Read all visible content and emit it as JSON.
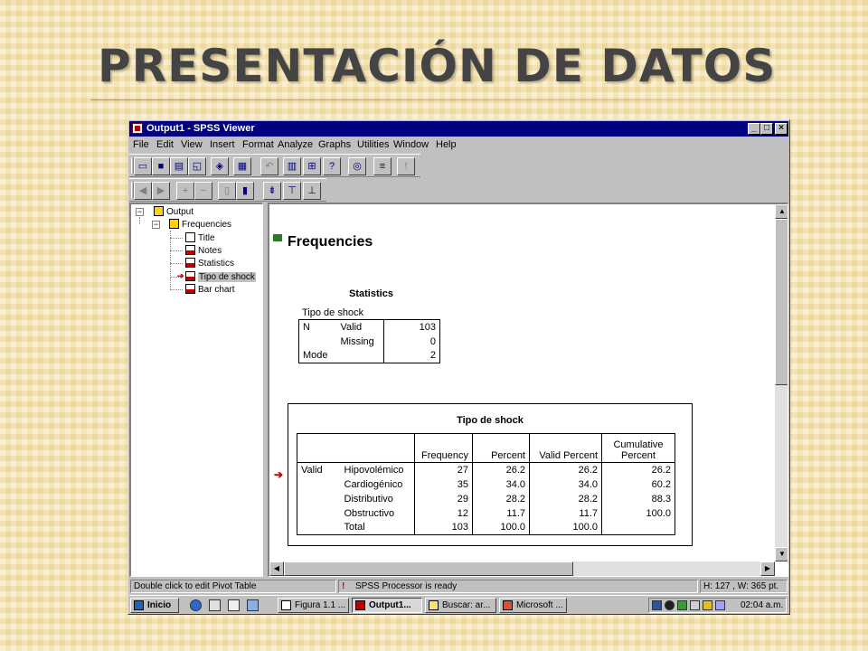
{
  "slide": {
    "title": "PRESENTACIÓN DE DATOS"
  },
  "window": {
    "title": "Output1 - SPSS Viewer",
    "caption_buttons": {
      "minimize": "_",
      "maximize": "□",
      "close": "×"
    }
  },
  "menubar": [
    "File",
    "Edit",
    "View",
    "Insert",
    "Format",
    "Analyze",
    "Graphs",
    "Utilities",
    "Window",
    "Help"
  ],
  "toolbar1": [
    "open-icon",
    "save-icon",
    "print-icon",
    "print-preview-icon",
    "export-icon",
    "recall-dialog-icon",
    "undo-icon",
    "goto-data-icon",
    "goto-case-icon",
    "variables-icon",
    "value-labels-icon",
    "designate-window-icon",
    "alert-icon"
  ],
  "toolbar2": [
    "promote-icon",
    "demote-icon",
    "expand-icon",
    "collapse-icon",
    "show-icon",
    "hide-icon",
    "insert-heading-icon",
    "insert-title-icon",
    "insert-text-icon"
  ],
  "tree": {
    "root": "Output",
    "group": "Frequencies",
    "items": [
      "Title",
      "Notes",
      "Statistics",
      "Tipo de shock",
      "Bar chart"
    ],
    "selected_index": 3
  },
  "content": {
    "heading": "Frequencies",
    "statistics": {
      "title": "Statistics",
      "variable": "Tipo de shock",
      "rows": [
        {
          "label": "N",
          "sublabel": "Valid",
          "value": "103"
        },
        {
          "label": "",
          "sublabel": "Missing",
          "value": "0"
        },
        {
          "label": "Mode",
          "sublabel": "",
          "value": "2"
        }
      ]
    },
    "frequency_table": {
      "title": "Tipo de shock",
      "headers": [
        "Frequency",
        "Percent",
        "Valid Percent",
        "Cumulative Percent"
      ],
      "header_cumulative_line1": "Cumulative",
      "header_cumulative_line2": "Percent",
      "group_label": "Valid",
      "rows": [
        {
          "category": "Hipovolémico",
          "frequency": "27",
          "percent": "26.2",
          "valid_percent": "26.2",
          "cumulative_percent": "26.2"
        },
        {
          "category": "Cardiogénico",
          "frequency": "35",
          "percent": "34.0",
          "valid_percent": "34.0",
          "cumulative_percent": "60.2"
        },
        {
          "category": "Distributivo",
          "frequency": "29",
          "percent": "28.2",
          "valid_percent": "28.2",
          "cumulative_percent": "88.3"
        },
        {
          "category": "Obstructivo",
          "frequency": "12",
          "percent": "11.7",
          "valid_percent": "11.7",
          "cumulative_percent": "100.0"
        },
        {
          "category": "Total",
          "frequency": "103",
          "percent": "100.0",
          "valid_percent": "100.0",
          "cumulative_percent": ""
        }
      ]
    }
  },
  "statusbar": {
    "hint": "Double click to edit Pivot Table",
    "processor": "SPSS Processor  is ready",
    "dimensions": "H: 127 , W: 365  pt."
  },
  "taskbar": {
    "start_label": "Inicio",
    "tasks": [
      "Figura 1.1 ...",
      "Output1...",
      "Buscar: ar...",
      "Microsoft ..."
    ],
    "active_task_index": 1,
    "clock": "02:04 a.m."
  },
  "colors": {
    "titlebar": "#000080",
    "face": "#c0c0c0",
    "accent_red": "#d00000"
  }
}
